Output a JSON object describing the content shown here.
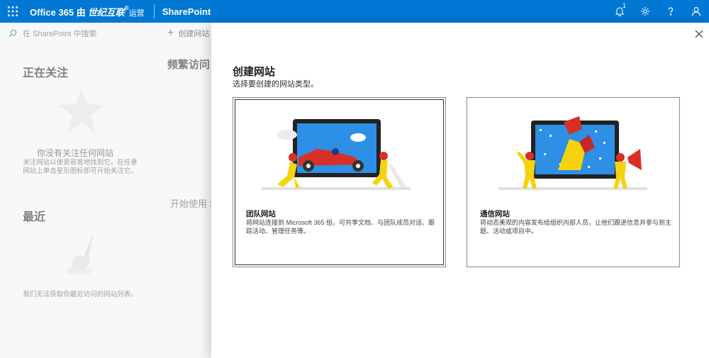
{
  "suitebar": {
    "brand_prefix": "Office 365 由",
    "brand_operator": "世纪互联",
    "brand_reg": "®",
    "brand_suffix": "运营",
    "app_name": "SharePoint",
    "notification_count": "1",
    "icons": [
      "app-launcher-icon",
      "bell-icon",
      "gear-icon",
      "help-icon",
      "person-icon"
    ],
    "accent": "#0078d4"
  },
  "leftrail": {
    "search_placeholder": "在 SharePoint 中搜索",
    "following": {
      "title": "正在关注",
      "empty_title": "你没有关注任何网站",
      "empty_desc": "关注网站以便更容易地找到它。在任意网站上单击星形图标即可开始关注它。"
    },
    "recent": {
      "title": "最近",
      "empty_desc": "我们无法获取你最近访问的网站列表。"
    }
  },
  "main": {
    "create_site_label": "创建网站",
    "frequent_title": "频繁访问",
    "start_use_text": "开始使用 S"
  },
  "panel": {
    "title": "创建网站",
    "subtitle": "选择要创建的网站类型。",
    "cards": [
      {
        "title": "团队网站",
        "desc": "将网站连接到 Microsoft 365 组，可共享文档、与团队成员对话、跟踪活动、管理任务等。"
      },
      {
        "title": "通信网站",
        "desc": "将动态美观的内容发布给组织内部人员，让他们跟进信息并参与到主题、活动或项目中。"
      }
    ]
  }
}
